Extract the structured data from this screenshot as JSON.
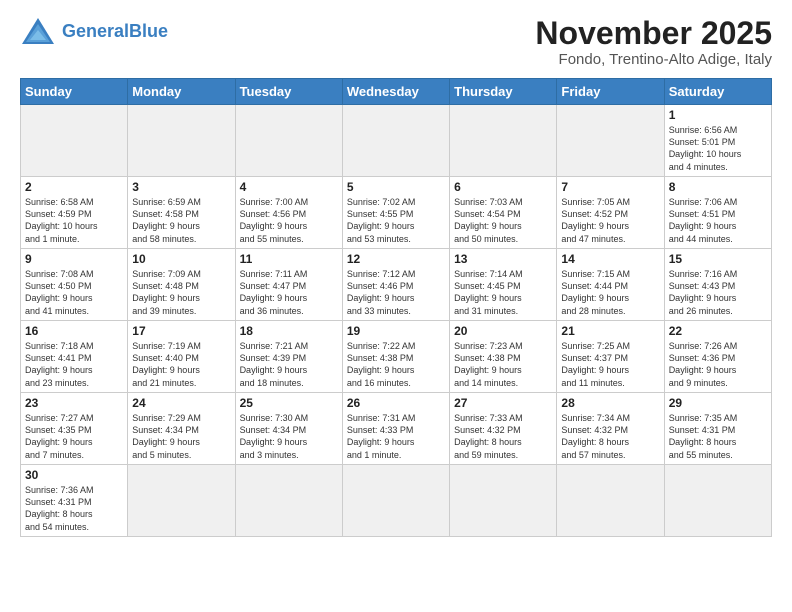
{
  "logo": {
    "text_general": "General",
    "text_blue": "Blue"
  },
  "title": "November 2025",
  "subtitle": "Fondo, Trentino-Alto Adige, Italy",
  "days_of_week": [
    "Sunday",
    "Monday",
    "Tuesday",
    "Wednesday",
    "Thursday",
    "Friday",
    "Saturday"
  ],
  "weeks": [
    [
      {
        "day": "",
        "info": "",
        "empty": true
      },
      {
        "day": "",
        "info": "",
        "empty": true
      },
      {
        "day": "",
        "info": "",
        "empty": true
      },
      {
        "day": "",
        "info": "",
        "empty": true
      },
      {
        "day": "",
        "info": "",
        "empty": true
      },
      {
        "day": "",
        "info": "",
        "empty": true
      },
      {
        "day": "1",
        "info": "Sunrise: 6:56 AM\nSunset: 5:01 PM\nDaylight: 10 hours\nand 4 minutes."
      }
    ],
    [
      {
        "day": "2",
        "info": "Sunrise: 6:58 AM\nSunset: 4:59 PM\nDaylight: 10 hours\nand 1 minute."
      },
      {
        "day": "3",
        "info": "Sunrise: 6:59 AM\nSunset: 4:58 PM\nDaylight: 9 hours\nand 58 minutes."
      },
      {
        "day": "4",
        "info": "Sunrise: 7:00 AM\nSunset: 4:56 PM\nDaylight: 9 hours\nand 55 minutes."
      },
      {
        "day": "5",
        "info": "Sunrise: 7:02 AM\nSunset: 4:55 PM\nDaylight: 9 hours\nand 53 minutes."
      },
      {
        "day": "6",
        "info": "Sunrise: 7:03 AM\nSunset: 4:54 PM\nDaylight: 9 hours\nand 50 minutes."
      },
      {
        "day": "7",
        "info": "Sunrise: 7:05 AM\nSunset: 4:52 PM\nDaylight: 9 hours\nand 47 minutes."
      },
      {
        "day": "8",
        "info": "Sunrise: 7:06 AM\nSunset: 4:51 PM\nDaylight: 9 hours\nand 44 minutes."
      }
    ],
    [
      {
        "day": "9",
        "info": "Sunrise: 7:08 AM\nSunset: 4:50 PM\nDaylight: 9 hours\nand 41 minutes."
      },
      {
        "day": "10",
        "info": "Sunrise: 7:09 AM\nSunset: 4:48 PM\nDaylight: 9 hours\nand 39 minutes."
      },
      {
        "day": "11",
        "info": "Sunrise: 7:11 AM\nSunset: 4:47 PM\nDaylight: 9 hours\nand 36 minutes."
      },
      {
        "day": "12",
        "info": "Sunrise: 7:12 AM\nSunset: 4:46 PM\nDaylight: 9 hours\nand 33 minutes."
      },
      {
        "day": "13",
        "info": "Sunrise: 7:14 AM\nSunset: 4:45 PM\nDaylight: 9 hours\nand 31 minutes."
      },
      {
        "day": "14",
        "info": "Sunrise: 7:15 AM\nSunset: 4:44 PM\nDaylight: 9 hours\nand 28 minutes."
      },
      {
        "day": "15",
        "info": "Sunrise: 7:16 AM\nSunset: 4:43 PM\nDaylight: 9 hours\nand 26 minutes."
      }
    ],
    [
      {
        "day": "16",
        "info": "Sunrise: 7:18 AM\nSunset: 4:41 PM\nDaylight: 9 hours\nand 23 minutes."
      },
      {
        "day": "17",
        "info": "Sunrise: 7:19 AM\nSunset: 4:40 PM\nDaylight: 9 hours\nand 21 minutes."
      },
      {
        "day": "18",
        "info": "Sunrise: 7:21 AM\nSunset: 4:39 PM\nDaylight: 9 hours\nand 18 minutes."
      },
      {
        "day": "19",
        "info": "Sunrise: 7:22 AM\nSunset: 4:38 PM\nDaylight: 9 hours\nand 16 minutes."
      },
      {
        "day": "20",
        "info": "Sunrise: 7:23 AM\nSunset: 4:38 PM\nDaylight: 9 hours\nand 14 minutes."
      },
      {
        "day": "21",
        "info": "Sunrise: 7:25 AM\nSunset: 4:37 PM\nDaylight: 9 hours\nand 11 minutes."
      },
      {
        "day": "22",
        "info": "Sunrise: 7:26 AM\nSunset: 4:36 PM\nDaylight: 9 hours\nand 9 minutes."
      }
    ],
    [
      {
        "day": "23",
        "info": "Sunrise: 7:27 AM\nSunset: 4:35 PM\nDaylight: 9 hours\nand 7 minutes."
      },
      {
        "day": "24",
        "info": "Sunrise: 7:29 AM\nSunset: 4:34 PM\nDaylight: 9 hours\nand 5 minutes."
      },
      {
        "day": "25",
        "info": "Sunrise: 7:30 AM\nSunset: 4:34 PM\nDaylight: 9 hours\nand 3 minutes."
      },
      {
        "day": "26",
        "info": "Sunrise: 7:31 AM\nSunset: 4:33 PM\nDaylight: 9 hours\nand 1 minute."
      },
      {
        "day": "27",
        "info": "Sunrise: 7:33 AM\nSunset: 4:32 PM\nDaylight: 8 hours\nand 59 minutes."
      },
      {
        "day": "28",
        "info": "Sunrise: 7:34 AM\nSunset: 4:32 PM\nDaylight: 8 hours\nand 57 minutes."
      },
      {
        "day": "29",
        "info": "Sunrise: 7:35 AM\nSunset: 4:31 PM\nDaylight: 8 hours\nand 55 minutes."
      }
    ],
    [
      {
        "day": "30",
        "info": "Sunrise: 7:36 AM\nSunset: 4:31 PM\nDaylight: 8 hours\nand 54 minutes."
      },
      {
        "day": "",
        "info": "",
        "empty": true
      },
      {
        "day": "",
        "info": "",
        "empty": true
      },
      {
        "day": "",
        "info": "",
        "empty": true
      },
      {
        "day": "",
        "info": "",
        "empty": true
      },
      {
        "day": "",
        "info": "",
        "empty": true
      },
      {
        "day": "",
        "info": "",
        "empty": true
      }
    ]
  ]
}
